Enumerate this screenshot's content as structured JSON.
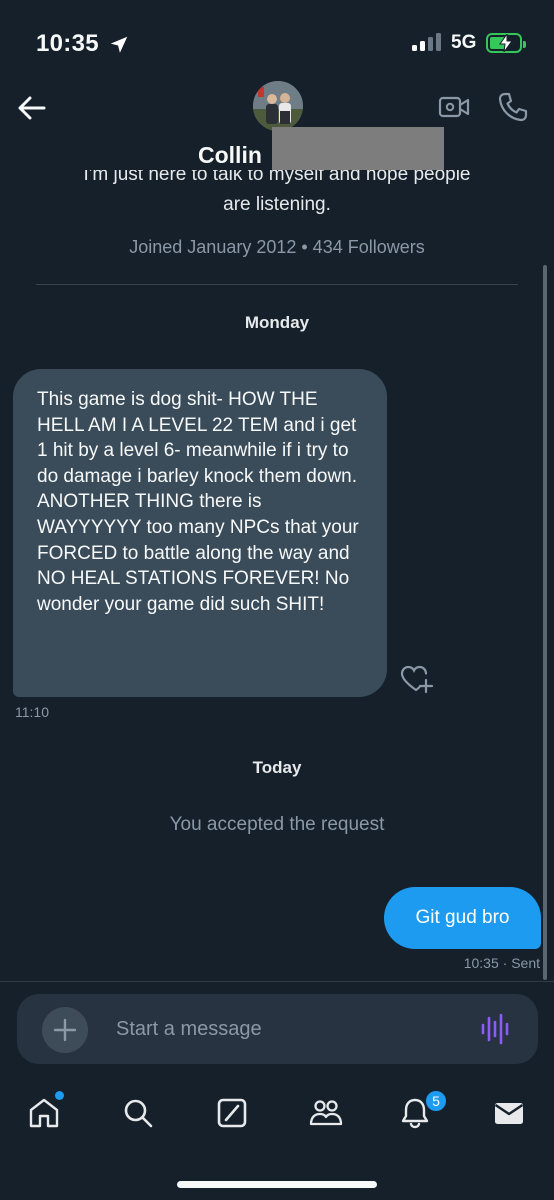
{
  "status_bar": {
    "time": "10:35",
    "network": "5G",
    "location_icon": "location-arrow-icon",
    "battery_icon": "battery-charging-icon",
    "signal_icon": "cellular-signal-icon",
    "battery_color": "#34c759"
  },
  "header": {
    "back_icon": "arrow-left-icon",
    "video_icon": "video-camera-icon",
    "phone_icon": "phone-icon",
    "name": "Collin",
    "bio_line1": "I'm just here to talk to myself and hope people",
    "bio_line2": "are listening.",
    "meta": "Joined January 2012 • 434 Followers"
  },
  "conversation": {
    "date_1": "Monday",
    "received_message": "This game is dog shit- HOW THE HELL AM I A LEVEL 22 TEM and i get 1 hit by a level 6- meanwhile if i try to do damage i barley knock them down. ANOTHER THING there is WAYYYYYY too many NPCs that your FORCED to battle along the way and NO HEAL STATIONS FOREVER! No wonder your game did such SHIT!",
    "received_time": "11:10",
    "react_icon": "heart-plus-icon",
    "date_2": "Today",
    "system_note": "You accepted the request",
    "sent_message": "Git gud bro",
    "sent_meta": "10:35 · Sent"
  },
  "composer": {
    "placeholder": "Start a message",
    "add_icon": "plus-icon",
    "voice_icon": "voice-waveform-icon"
  },
  "tab_bar": {
    "home_icon": "home-icon",
    "search_icon": "search-icon",
    "grok_icon": "grok-icon",
    "communities_icon": "communities-icon",
    "notifications_icon": "bell-icon",
    "messages_icon": "envelope-icon",
    "notifications_badge": "5"
  },
  "colors": {
    "background": "#15202b",
    "accent": "#1d9bf0",
    "received_bubble": "#3a4b5a",
    "voice_icon": "#8b5cf6"
  }
}
